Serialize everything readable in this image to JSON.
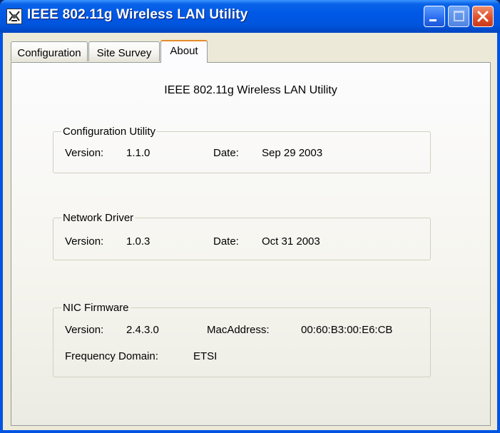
{
  "window": {
    "title": "IEEE 802.11g Wireless LAN Utility"
  },
  "tabs": [
    {
      "label": "Configuration",
      "active": false
    },
    {
      "label": "Site Survey",
      "active": false
    },
    {
      "label": "About",
      "active": true
    }
  ],
  "about": {
    "heading": "IEEE 802.11g Wireless LAN Utility",
    "configuration_utility": {
      "legend": "Configuration Utility",
      "version_label": "Version:",
      "version_value": "1.1.0",
      "date_label": "Date:",
      "date_value": "Sep 29 2003"
    },
    "network_driver": {
      "legend": "Network Driver",
      "version_label": "Version:",
      "version_value": "1.0.3",
      "date_label": "Date:",
      "date_value": "Oct 31 2003"
    },
    "nic_firmware": {
      "legend": "NIC Firmware",
      "version_label": "Version:",
      "version_value": "2.4.3.0",
      "mac_label": "MacAddress:",
      "mac_value": "00:60:B3:00:E6:CB",
      "freq_label": "Frequency Domain:",
      "freq_value": "ETSI"
    }
  },
  "colors": {
    "titlebar": "#0058E6",
    "close_button": "#E0502A",
    "dialog_background": "#ECE9D8",
    "active_tab_accent": "#E68B2C"
  },
  "icons": {
    "app": "wireless-utility-icon",
    "minimize": "minimize-icon",
    "maximize": "maximize-icon",
    "close": "close-icon"
  }
}
